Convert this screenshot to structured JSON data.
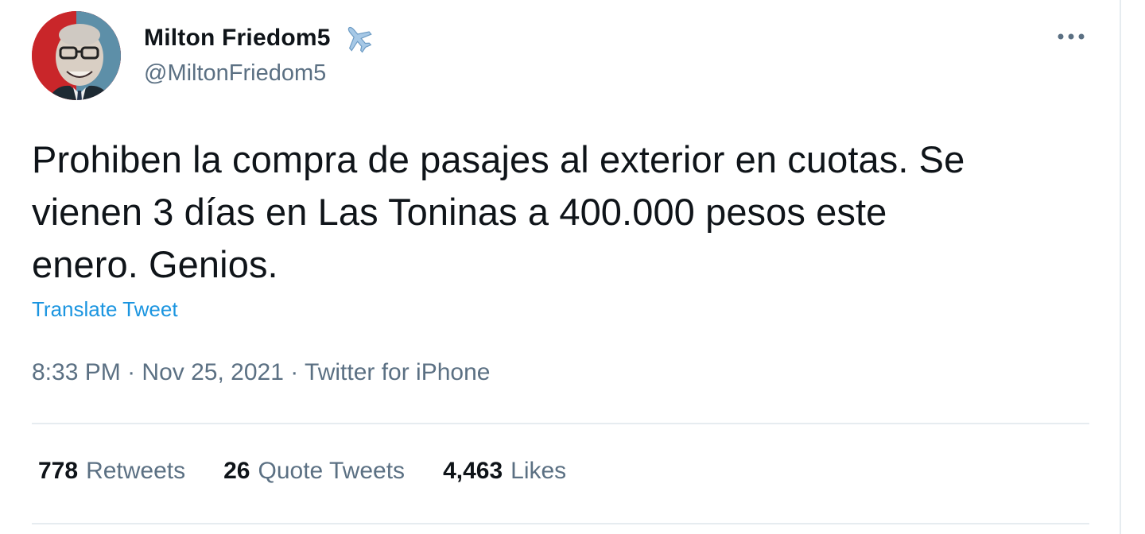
{
  "author": {
    "display_name": "Milton Friedom5",
    "handle": "@MiltonFriedom5",
    "badge_icon": "airplane-icon"
  },
  "tweet": {
    "lines": [
      "Prohiben la compra de pasajes al exterior en cuotas. Se",
      "vienen 3 días en Las Toninas a 400.000 pesos este",
      "enero. Genios."
    ],
    "translate_label": "Translate Tweet"
  },
  "meta": {
    "time": "8:33 PM",
    "separator": "·",
    "date": "Nov 25, 2021",
    "source": "Twitter for iPhone"
  },
  "stats": [
    {
      "count": "778",
      "label": "Retweets"
    },
    {
      "count": "26",
      "label": "Quote Tweets"
    },
    {
      "count": "4,463",
      "label": "Likes"
    }
  ],
  "colors": {
    "primary_text": "#0f1419",
    "secondary_text": "#5b7083",
    "link": "#1b95e0",
    "divider": "#e6ecf0"
  }
}
